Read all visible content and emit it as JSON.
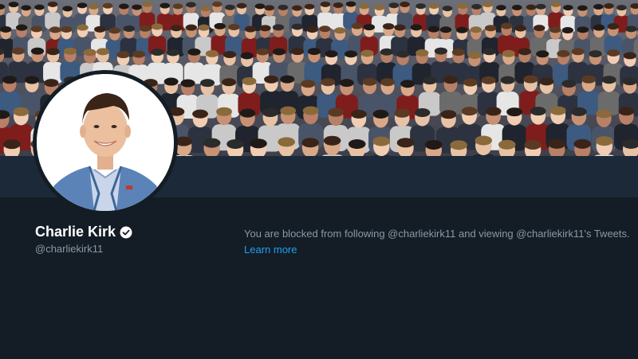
{
  "profile": {
    "display_name": "Charlie Kirk",
    "handle": "@charliekirk11",
    "verified": true
  },
  "blocked": {
    "message": "You are blocked from following @charliekirk11 and viewing @charliekirk11's Tweets.",
    "link_text": "Learn more"
  },
  "icons": {
    "verified": "verified-badge-icon"
  },
  "colors": {
    "background": "#141d26",
    "nav_bar": "#1c2938",
    "secondary_text": "#8899a6",
    "link": "#1da1f2"
  }
}
